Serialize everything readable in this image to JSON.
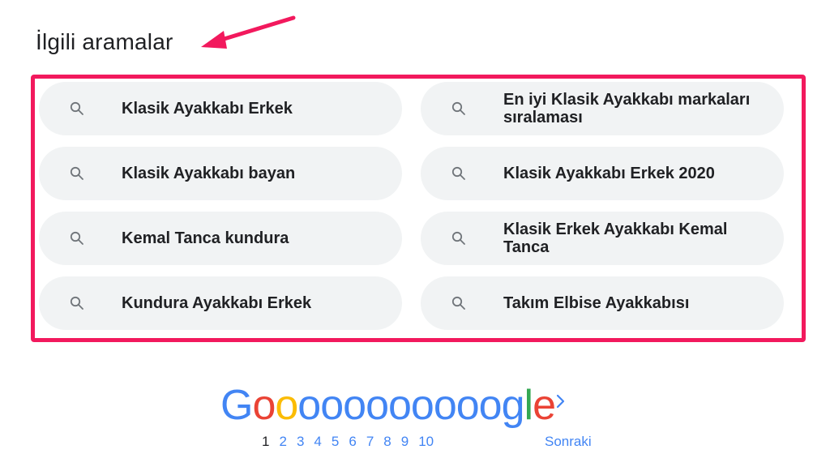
{
  "heading": "İlgili aramalar",
  "colors": {
    "highlight": "#f2195d",
    "pill_background": "#f1f3f4",
    "link_blue": "#4285f4",
    "text": "#202124"
  },
  "related_searches": [
    {
      "label": "Klasik Ayakkabı Erkek",
      "icon": "search-icon"
    },
    {
      "label": "En iyi Klasik Ayakkabı markaları sıralaması",
      "icon": "search-icon"
    },
    {
      "label": "Klasik Ayakkabı bayan",
      "icon": "search-icon"
    },
    {
      "label": "Klasik Ayakkabı Erkek 2020",
      "icon": "search-icon"
    },
    {
      "label": "Kemal Tanca kundura",
      "icon": "search-icon"
    },
    {
      "label": "Klasik Erkek Ayakkabı Kemal Tanca",
      "icon": "search-icon"
    },
    {
      "label": "Kundura Ayakkabı Erkek",
      "icon": "search-icon"
    },
    {
      "label": "Takım Elbise Ayakkabısı",
      "icon": "search-icon"
    }
  ],
  "pagination": {
    "logo_letters": [
      "G",
      "o",
      "o",
      "o",
      "o",
      "o",
      "o",
      "o",
      "o",
      "o",
      "o",
      "o",
      "g",
      "l",
      "e"
    ],
    "pages": [
      "1",
      "2",
      "3",
      "4",
      "5",
      "6",
      "7",
      "8",
      "9",
      "10"
    ],
    "current_page": "1",
    "next_label": "Sonraki",
    "next_icon": "chevron-right-icon"
  }
}
